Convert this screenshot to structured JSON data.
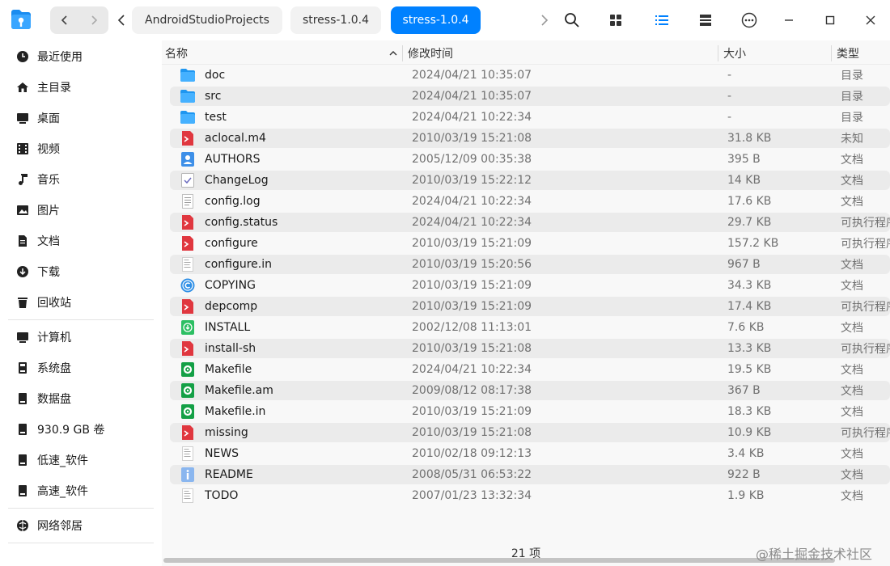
{
  "toolbar": {
    "breadcrumbs": [
      {
        "label": "AndroidStudioProjects"
      },
      {
        "label": "stress-1.0.4"
      },
      {
        "label": "stress-1.0.4"
      }
    ]
  },
  "sidebar": {
    "items": [
      {
        "label": "最近使用",
        "icon": "clock-icon"
      },
      {
        "label": "主目录",
        "icon": "home-icon"
      },
      {
        "label": "桌面",
        "icon": "desktop-icon"
      },
      {
        "label": "视频",
        "icon": "video-icon"
      },
      {
        "label": "音乐",
        "icon": "music-icon"
      },
      {
        "label": "图片",
        "icon": "picture-icon"
      },
      {
        "label": "文档",
        "icon": "document-icon"
      },
      {
        "label": "下载",
        "icon": "download-icon"
      },
      {
        "label": "回收站",
        "icon": "trash-icon"
      },
      {
        "label": "计算机",
        "icon": "computer-icon"
      },
      {
        "label": "系统盘",
        "icon": "disk-icon"
      },
      {
        "label": "数据盘",
        "icon": "disk-icon"
      },
      {
        "label": "930.9 GB 卷",
        "icon": "disk-icon"
      },
      {
        "label": "低速_软件",
        "icon": "disk-icon"
      },
      {
        "label": "高速_软件",
        "icon": "disk-icon"
      },
      {
        "label": "网络邻居",
        "icon": "network-icon"
      }
    ]
  },
  "table": {
    "columns": {
      "name": "名称",
      "mtime": "修改时间",
      "size": "大小",
      "type": "类型"
    },
    "rows": [
      {
        "name": "doc",
        "mtime": "2024/04/21 10:35:07",
        "size": "-",
        "type": "目录",
        "icon": "folder"
      },
      {
        "name": "src",
        "mtime": "2024/04/21 10:35:07",
        "size": "-",
        "type": "目录",
        "icon": "folder"
      },
      {
        "name": "test",
        "mtime": "2024/04/21 10:22:34",
        "size": "-",
        "type": "目录",
        "icon": "folder"
      },
      {
        "name": "aclocal.m4",
        "mtime": "2010/03/19 15:21:08",
        "size": "31.8 KB",
        "type": "未知",
        "icon": "script"
      },
      {
        "name": "AUTHORS",
        "mtime": "2005/12/09 00:35:38",
        "size": "395 B",
        "type": "文档",
        "icon": "authors"
      },
      {
        "name": "ChangeLog",
        "mtime": "2010/03/19 15:22:12",
        "size": "14 KB",
        "type": "文档",
        "icon": "check"
      },
      {
        "name": "config.log",
        "mtime": "2024/04/21 10:22:34",
        "size": "17.6 KB",
        "type": "文档",
        "icon": "text"
      },
      {
        "name": "config.status",
        "mtime": "2024/04/21 10:22:34",
        "size": "29.7 KB",
        "type": "可执行程序",
        "icon": "script"
      },
      {
        "name": "configure",
        "mtime": "2010/03/19 15:21:09",
        "size": "157.2 KB",
        "type": "可执行程序",
        "icon": "script"
      },
      {
        "name": "configure.in",
        "mtime": "2010/03/19 15:20:56",
        "size": "967 B",
        "type": "文档",
        "icon": "plain"
      },
      {
        "name": "COPYING",
        "mtime": "2010/03/19 15:21:09",
        "size": "34.3 KB",
        "type": "文档",
        "icon": "copyright"
      },
      {
        "name": "depcomp",
        "mtime": "2010/03/19 15:21:09",
        "size": "17.4 KB",
        "type": "可执行程序",
        "icon": "script"
      },
      {
        "name": "INSTALL",
        "mtime": "2002/12/08 11:13:01",
        "size": "7.6 KB",
        "type": "文档",
        "icon": "install"
      },
      {
        "name": "install-sh",
        "mtime": "2010/03/19 15:21:08",
        "size": "13.3 KB",
        "type": "可执行程序",
        "icon": "script"
      },
      {
        "name": "Makefile",
        "mtime": "2024/04/21 10:22:34",
        "size": "19.5 KB",
        "type": "文档",
        "icon": "make"
      },
      {
        "name": "Makefile.am",
        "mtime": "2009/08/12 08:17:38",
        "size": "367 B",
        "type": "文档",
        "icon": "make"
      },
      {
        "name": "Makefile.in",
        "mtime": "2010/03/19 15:21:09",
        "size": "18.3 KB",
        "type": "文档",
        "icon": "make"
      },
      {
        "name": "missing",
        "mtime": "2010/03/19 15:21:08",
        "size": "10.9 KB",
        "type": "可执行程序",
        "icon": "script"
      },
      {
        "name": "NEWS",
        "mtime": "2010/02/18 09:12:13",
        "size": "3.4 KB",
        "type": "文档",
        "icon": "plain"
      },
      {
        "name": "README",
        "mtime": "2008/05/31 06:53:22",
        "size": "922 B",
        "type": "文档",
        "icon": "info"
      },
      {
        "name": "TODO",
        "mtime": "2007/01/23 13:32:34",
        "size": "1.9 KB",
        "type": "文档",
        "icon": "plain"
      }
    ]
  },
  "status": {
    "count": "21 项"
  },
  "watermark": "@稀土掘金技术社区",
  "colors": {
    "accent": "#0081ff",
    "folder": "#1e96f0",
    "script": "#e0373f",
    "make": "#14a046"
  }
}
